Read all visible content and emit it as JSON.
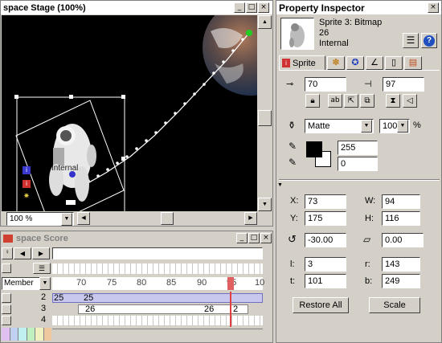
{
  "stage": {
    "title": "space Stage (100%)",
    "zoom": "100 %",
    "sprite_label": "Internal"
  },
  "score": {
    "title": "space Score",
    "member_select": "Member",
    "frame_numbers": [
      "70",
      "75",
      "80",
      "85",
      "90",
      "95",
      "10"
    ],
    "channels": [
      "2",
      "3",
      "4"
    ],
    "ch2_cells": [
      "25",
      "25"
    ],
    "ch3_cells": [
      "26",
      "26",
      "2"
    ]
  },
  "inspector": {
    "title": "Property Inspector",
    "sprite_name": "Sprite 3: Bitmap",
    "member_number": "26",
    "cast": "Internal",
    "tab_sprite": "Sprite",
    "reg_x": "70",
    "reg_y": "97",
    "ink": "Matte",
    "blend": "100",
    "percent": "%",
    "fg_value": "255",
    "bg_value": "0",
    "x_label": "X:",
    "x": "73",
    "y_label": "Y:",
    "y": "175",
    "w_label": "W:",
    "w": "94",
    "h_label": "H:",
    "h": "116",
    "rotation": "-30.00",
    "skew": "0.00",
    "l_label": "l:",
    "l": "3",
    "t_label": "t:",
    "t": "101",
    "r_label": "r:",
    "r": "143",
    "b_label": "b:",
    "b": "249",
    "restore_all": "Restore All",
    "scale": "Scale"
  }
}
